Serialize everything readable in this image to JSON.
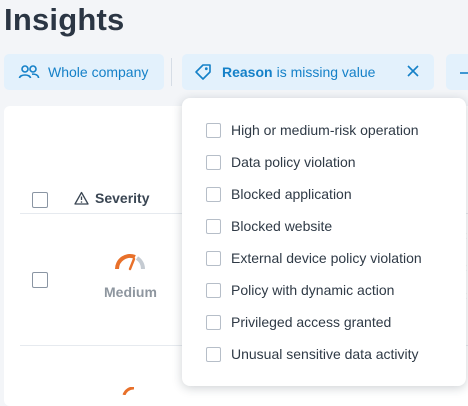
{
  "page": {
    "title": "Insights"
  },
  "filters": {
    "company_label": "Whole company",
    "reason_key": "Reason",
    "reason_rest": "is missing value"
  },
  "table": {
    "severity_header": "Severity",
    "rows": [
      {
        "severity": "Medium"
      }
    ]
  },
  "dropdown": {
    "options": [
      "High or medium-risk operation",
      "Data policy violation",
      "Blocked application",
      "Blocked website",
      "External device policy violation",
      "Policy with dynamic action",
      "Privileged access granted",
      "Unusual sensitive data activity"
    ]
  },
  "colors": {
    "accent": "#1581c8",
    "chip_bg": "#e3f1fc",
    "gauge_orange": "#e8702a"
  },
  "icons": {
    "company": "users-icon",
    "reason": "tag-icon",
    "remove": "close-icon",
    "severity_header": "warning-triangle-icon",
    "severity_row": "gauge-icon"
  }
}
